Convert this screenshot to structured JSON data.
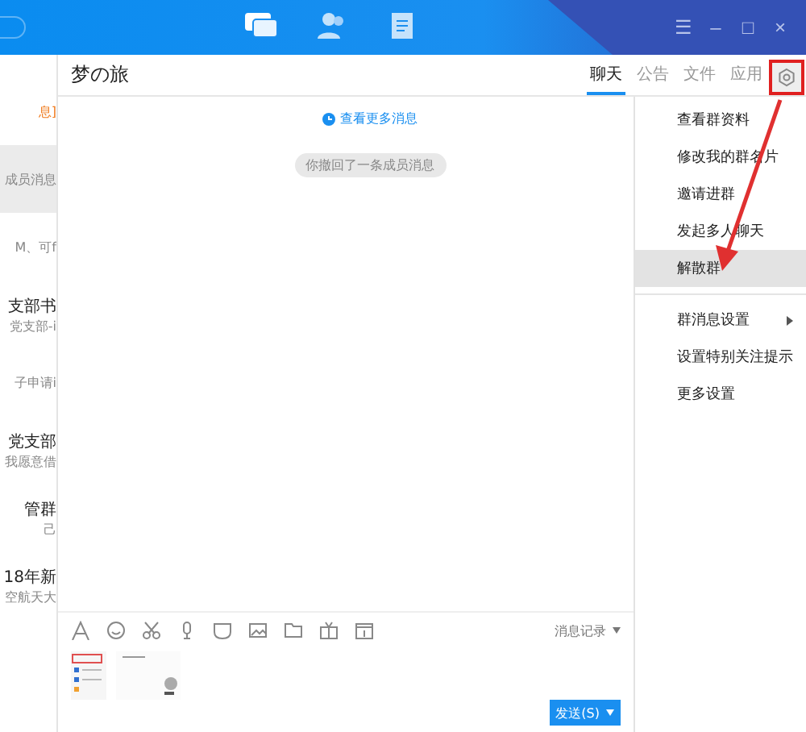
{
  "top_nav": [
    {
      "kind": "chat",
      "selected": true
    },
    {
      "kind": "contacts",
      "selected": false
    },
    {
      "kind": "notes",
      "selected": false
    }
  ],
  "window_controls": [
    "☰",
    "–",
    "□",
    "×"
  ],
  "conversations": [
    {
      "preview": "息]",
      "alert": true,
      "selected": false
    },
    {
      "preview": "成员消息",
      "alert": false,
      "selected": true
    },
    {
      "preview": "M、可f",
      "alert": false,
      "selected": false
    },
    {
      "name": "支部书",
      "preview": "党支部-i",
      "alert": false,
      "selected": false
    },
    {
      "preview": "子申请i",
      "alert": false,
      "selected": false
    },
    {
      "name": "党支部",
      "preview": "我愿意借",
      "alert": false,
      "selected": false
    },
    {
      "name": "管群",
      "preview": "己",
      "alert": false,
      "selected": false
    },
    {
      "name": "18年新",
      "preview": "空航天大",
      "alert": false,
      "selected": false
    }
  ],
  "chat": {
    "title": "梦の旅",
    "tabs": [
      {
        "label": "聊天",
        "selected": true
      },
      {
        "label": "公告",
        "selected": false
      },
      {
        "label": "文件",
        "selected": false
      },
      {
        "label": "应用",
        "selected": false
      }
    ],
    "more_messages": "查看更多消息",
    "system_notice": "你撤回了一条成员消息",
    "history": "消息记录",
    "send": "发送(S)"
  },
  "menu": [
    {
      "label": "查看群资料",
      "selected": false,
      "submenu": false
    },
    {
      "label": "修改我的群名片",
      "selected": false,
      "submenu": false
    },
    {
      "label": "邀请进群",
      "selected": false,
      "submenu": false
    },
    {
      "label": "发起多人聊天",
      "selected": false,
      "submenu": false
    },
    {
      "label": "解散群",
      "selected": true,
      "submenu": false
    },
    {
      "label": "群消息设置",
      "selected": false,
      "submenu": true,
      "divider_before": true
    },
    {
      "label": "设置特别关注提示",
      "selected": false,
      "submenu": false
    },
    {
      "label": "更多设置",
      "selected": false,
      "submenu": false
    }
  ]
}
